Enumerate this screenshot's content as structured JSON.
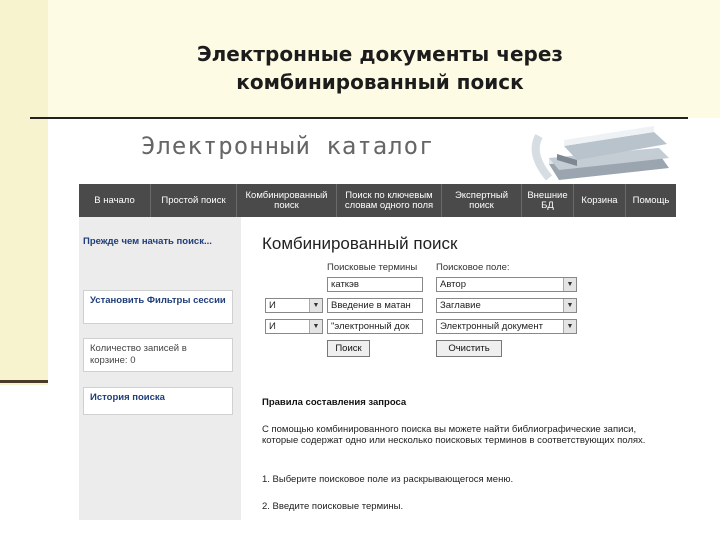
{
  "slide": {
    "title_line1": "Электронные документы через",
    "title_line2": "комбинированный поиск"
  },
  "site": {
    "title": "Электронный каталог",
    "logo_icon": "books-icon"
  },
  "nav": {
    "items": [
      {
        "label": "В начало"
      },
      {
        "label": "Простой поиск"
      },
      {
        "label": "Комбинированный поиск"
      },
      {
        "label": "Поиск по ключевым словам одного поля"
      },
      {
        "label": "Экспертный поиск"
      },
      {
        "label": "Внешние БД"
      },
      {
        "label": "Корзина"
      },
      {
        "label": "Помощь"
      }
    ]
  },
  "sidebar": {
    "before_link": "Прежде чем начать поиск...",
    "filters_link": "Установить Фильтры сессии",
    "cart_count_text": "Количество записей в корзине: 0",
    "history_link": "История поиска"
  },
  "search": {
    "title": "Комбинированный поиск",
    "terms_label": "Поисковые термины",
    "field_label": "Поисковое поле:",
    "rows": [
      {
        "op": "",
        "term": "каткэв",
        "field": "Автор"
      },
      {
        "op": "И",
        "term": "Введение в матан",
        "field": "Заглавие"
      },
      {
        "op": "И",
        "term": "\"электронный док",
        "field": "Электронный документ"
      }
    ],
    "search_button": "Поиск",
    "clear_button": "Очистить"
  },
  "rules": {
    "title": "Правила составления запроса",
    "intro": "С помощью комбинированного поиска вы можете найти библиографические записи, которые содержат одно или несколько поисковых терминов в соответствующих полях.",
    "step1": "1. Выберите поисковое поле из раскрывающегося меню.",
    "step2": "2. Введите поисковые термины."
  }
}
